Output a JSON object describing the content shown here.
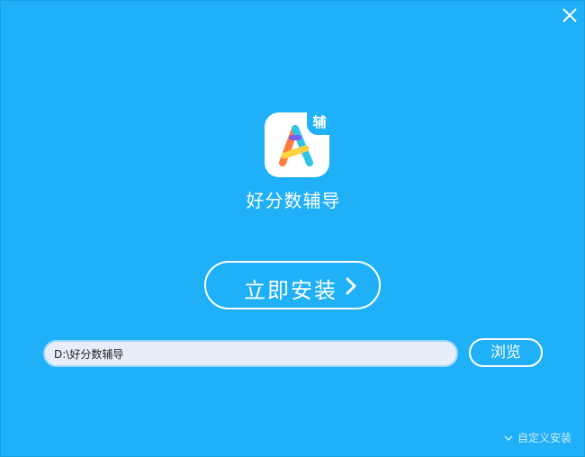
{
  "app": {
    "name": "好分数辅导",
    "badge": "辅"
  },
  "actions": {
    "install_label": "立即安装",
    "browse_label": "浏览",
    "custom_install_label": "自定义安装"
  },
  "path": {
    "value": "D:\\好分数辅导"
  },
  "colors": {
    "background": "#1fb0f7",
    "text": "#ffffff",
    "input_background": "#e8eef9"
  },
  "icons": {
    "close": "close-icon",
    "install_arrow": "chevron-right-icon",
    "custom_install": "chevron-down-icon",
    "app_logo": "app-logo-icon"
  }
}
